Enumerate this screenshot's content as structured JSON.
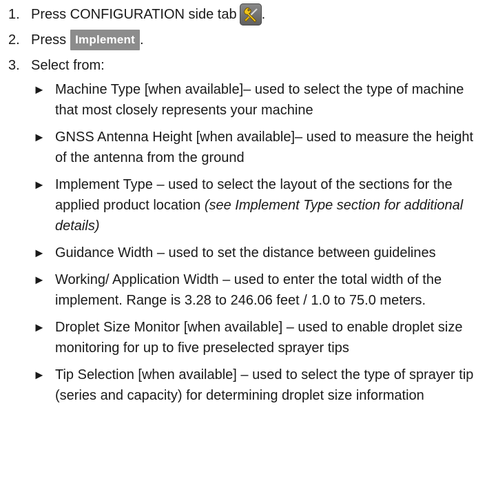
{
  "steps": [
    {
      "number": "1.",
      "text": "Press CONFIGURATION side tab",
      "suffix": ".",
      "icon": "wrench-screwdriver-icon"
    },
    {
      "number": "2.",
      "text": "Press",
      "button_label": "Implement",
      "suffix": "."
    },
    {
      "number": "3.",
      "text": "Select from:"
    }
  ],
  "bullet_glyph": "►",
  "items": [
    {
      "text": "Machine Type [when available]– used to select the type of machine that most closely represents your machine"
    },
    {
      "text": "GNSS Antenna Height [when available]– used to measure the height of the antenna from the ground"
    },
    {
      "text": "Implement Type – used to select the layout of the sections for the applied product location ",
      "note": "(see Implement Type section for additional details)"
    },
    {
      "text": "Guidance Width – used to set the distance between guidelines"
    },
    {
      "text": "Working/ Application Width – used to enter the total width of the implement. Range is 3.28 to 246.06 feet / 1.0 to 75.0 meters."
    },
    {
      "text": "Droplet Size Monitor [when available] – used to enable droplet size monitoring for up to five preselected sprayer tips"
    },
    {
      "text": "Tip Selection [when available] – used to select the type of sprayer tip (series and capacity) for determining droplet size information"
    }
  ]
}
